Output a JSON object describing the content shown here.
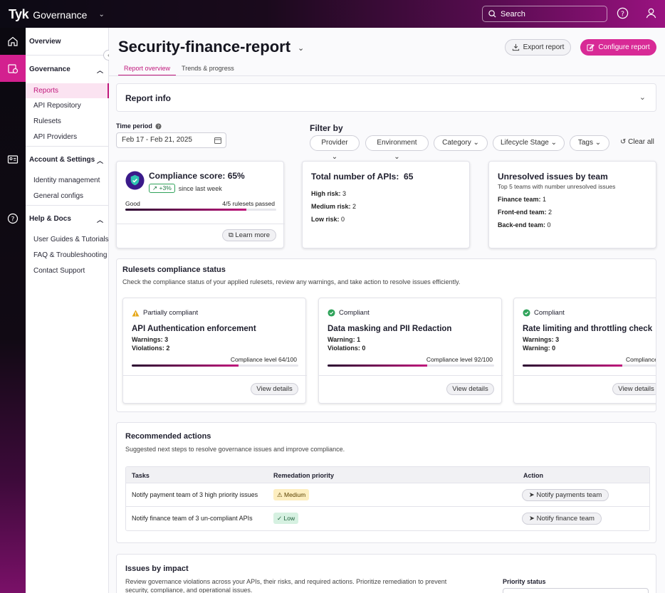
{
  "app": {
    "logo": "Tyk",
    "product": "Governance"
  },
  "topbar": {
    "search_placeholder": "Search"
  },
  "sidebar": {
    "overview": "Overview",
    "sections": [
      {
        "label": "Governance",
        "items": [
          "Reports",
          "API Repository",
          "Rulesets",
          "API Providers"
        ]
      },
      {
        "label": "Account & Settings",
        "items": [
          "Identity management",
          "General configs"
        ]
      },
      {
        "label": "Help & Docs",
        "items": [
          "User Guides & Tutorials",
          "FAQ & Troubleshooting",
          "Contact Support"
        ]
      }
    ],
    "active_item": "Reports"
  },
  "page": {
    "title": "Security-finance-report",
    "export_label": "Export report",
    "configure_label": "Configure report",
    "tabs": [
      "Report overview",
      "Trends & progress"
    ],
    "active_tab": "Report overview"
  },
  "report_info": {
    "title": "Report info"
  },
  "time_period": {
    "label": "Time period",
    "value": "Feb 17 - Feb 21, 2025"
  },
  "filters": {
    "title": "Filter by",
    "chips": [
      "Provider",
      "Environment",
      "Category",
      "Lifecycle Stage",
      "Tags"
    ],
    "clear_label": "Clear all"
  },
  "compliance": {
    "title": "Compliance score: 65%",
    "delta": "+3%",
    "delta_suffix": "since last week",
    "status": "Good",
    "rulesets_passed": "4/5 rulesets passed",
    "progress": 0.8,
    "learn_more": "Learn more"
  },
  "total_apis": {
    "title": "Total number of APIs:",
    "value": "65",
    "rows": [
      {
        "k": "High risk:",
        "v": "3"
      },
      {
        "k": "Medium risk:",
        "v": "2"
      },
      {
        "k": "Low risk:",
        "v": "0"
      }
    ]
  },
  "unresolved": {
    "title": "Unresolved issues by team",
    "subtitle": "Top 5 teams with number unresolved issues",
    "rows": [
      {
        "k": "Finance team:",
        "v": "1"
      },
      {
        "k": "Front-end team:",
        "v": "2"
      },
      {
        "k": "Back-end team:",
        "v": "0"
      }
    ]
  },
  "rulesets": {
    "title": "Rulesets compliance status",
    "subtitle": "Check the compliance status of your applied rulesets, review any warnings, and take action to resolve issues efficiently.",
    "cards": [
      {
        "status": "Partially compliant",
        "status_type": "warning",
        "name": "API Authentication enforcement",
        "line1": "Warnings: 3",
        "line2": "Violations: 2",
        "level_label": "Compliance level 64/100",
        "level": 0.64,
        "action": "View details"
      },
      {
        "status": "Compliant",
        "status_type": "ok",
        "name": "Data masking and PII Redaction",
        "line1": "Warning: 1",
        "line2": "Violations: 0",
        "level_label": "Compliance level 92/100",
        "level": 0.6,
        "action": "View details"
      },
      {
        "status": "Compliant",
        "status_type": "ok",
        "name": "Rate limiting and throttling check",
        "line1": "Warnings: 3",
        "line2": "Warning: 0",
        "level_label": "Compliance",
        "level": 0.6,
        "action": "View details"
      }
    ]
  },
  "recommended": {
    "title": "Recommended actions",
    "subtitle": "Suggested next steps to resolve governance issues and improve compliance.",
    "headers": [
      "Tasks",
      "Remedation priority",
      "Action"
    ],
    "rows": [
      {
        "task": "Notify payment team of 3 high priority issues",
        "priority": "Medium",
        "action": "Notify payments team"
      },
      {
        "task": "Notify finance team of 3 un-compliant APIs",
        "priority": "Low",
        "action": "Notify finance team"
      }
    ]
  },
  "issues": {
    "title": "Issues by impact",
    "subtitle": "Review governance violations across your APIs, their risks, and required actions. Prioritize remediation to prevent security, compliance, and operational issues.",
    "priority_label": "Priority status"
  },
  "colors": {
    "accent": "#d82a96",
    "active_text": "#c0187c",
    "ok": "#2fa35a",
    "warning": "#e6a81a"
  }
}
